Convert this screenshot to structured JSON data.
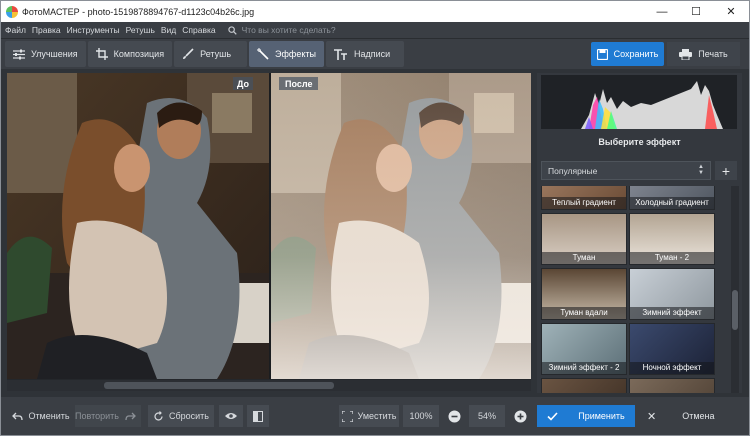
{
  "window": {
    "title": "ФотоМАСТЕР - photo-1519878894767-d1123c04b26c.jpg",
    "controls": [
      "—",
      "☐",
      "✕"
    ]
  },
  "menu": {
    "items": [
      "Файл",
      "Правка",
      "Инструменты",
      "Ретушь",
      "Вид",
      "Справка"
    ],
    "search_placeholder": "Что вы хотите сделать?"
  },
  "toolbar": {
    "tabs": [
      {
        "label": "Улучшения",
        "icon": "sliders-icon"
      },
      {
        "label": "Композиция",
        "icon": "crop-icon"
      },
      {
        "label": "Ретушь",
        "icon": "brush-icon"
      },
      {
        "label": "Эффекты",
        "icon": "magic-wand-icon",
        "active": true
      },
      {
        "label": "Надписи",
        "icon": "text-icon"
      }
    ],
    "save_label": "Сохранить",
    "print_label": "Печать"
  },
  "canvas": {
    "before_label": "До",
    "after_label": "После"
  },
  "panel": {
    "title": "Выберите эффект",
    "category": "Популярные",
    "add_label": "+",
    "effects": [
      {
        "label": "Теплый градиент"
      },
      {
        "label": "Холодный градиент"
      },
      {
        "label": "Туман"
      },
      {
        "label": "Туман - 2"
      },
      {
        "label": "Туман вдали"
      },
      {
        "label": "Зимний эффект"
      },
      {
        "label": "Зимний эффект - 2"
      },
      {
        "label": "Ночной эффект"
      }
    ]
  },
  "bottom": {
    "undo_label": "Отменить",
    "redo_label": "Повторить",
    "reset_label": "Сбросить",
    "fit_label": "Уместить",
    "zoom_100": "100%",
    "zoom_value": "54%",
    "apply_label": "Применить",
    "cancel_label": "Отмена"
  },
  "colors": {
    "accent": "#1f7bd3",
    "background": "#2f3338",
    "toolbar": "#3a3e44",
    "active_tab": "#566274"
  }
}
